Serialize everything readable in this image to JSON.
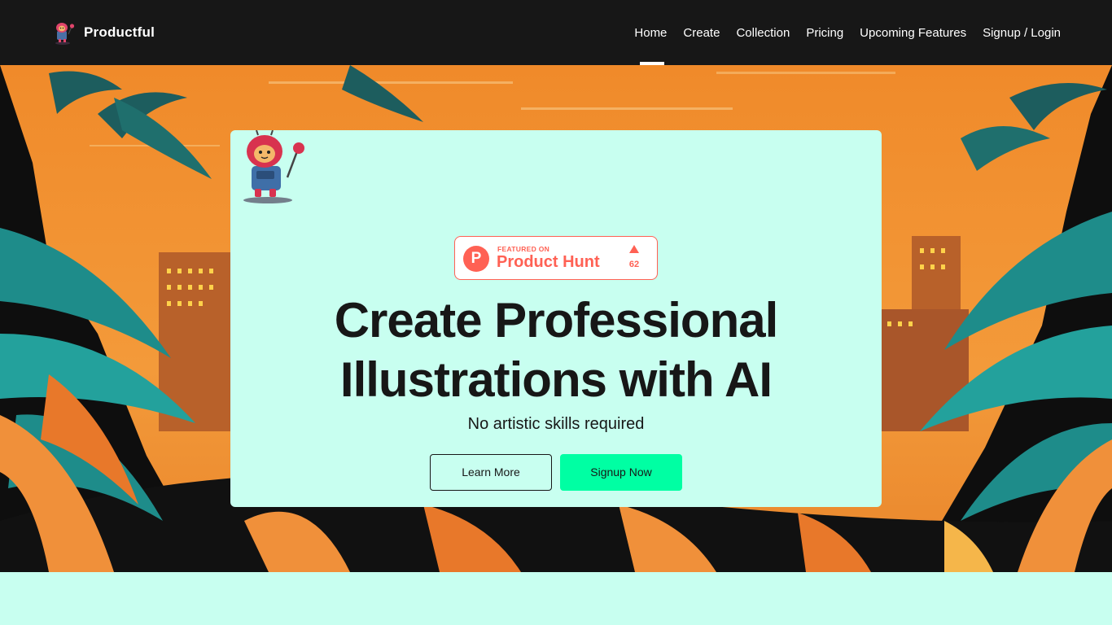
{
  "brand": {
    "name": "Productful",
    "logo_icon": "robot-mascot-icon"
  },
  "nav": {
    "items": [
      {
        "label": "Home",
        "active": true
      },
      {
        "label": "Create",
        "active": false
      },
      {
        "label": "Collection",
        "active": false
      },
      {
        "label": "Pricing",
        "active": false
      },
      {
        "label": "Upcoming Features",
        "active": false
      },
      {
        "label": "Signup / Login",
        "active": false
      }
    ]
  },
  "hero": {
    "background_icon": "jungle-sunset-illustration",
    "product_hunt": {
      "featured_text": "FEATURED ON",
      "name": "Product Hunt",
      "logo_letter": "P",
      "upvotes": "62"
    },
    "headline_line1": "Create Professional",
    "headline_line2": "Illustrations with AI",
    "subheadline": "No artistic skills required",
    "learn_more_label": "Learn More",
    "signup_label": "Signup Now"
  },
  "colors": {
    "topbar": "#171717",
    "card": "#c8fff0",
    "accent": "#00ffa3",
    "product_hunt": "#ff6154"
  }
}
